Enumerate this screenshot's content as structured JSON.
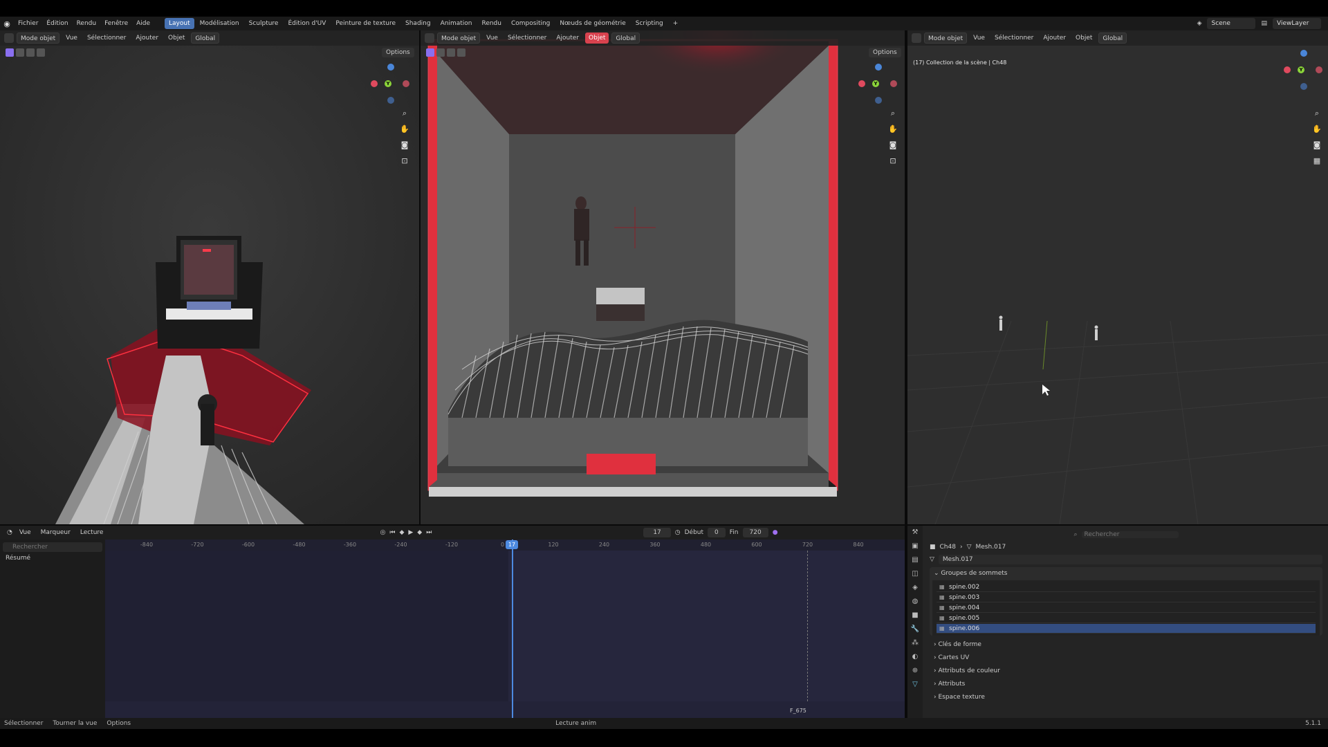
{
  "menu": {
    "items": [
      "Fichier",
      "Édition",
      "Rendu",
      "Fenêtre",
      "Aide"
    ],
    "workspaces": [
      "Layout",
      "Modélisation",
      "Sculpture",
      "Édition d'UV",
      "Peinture de texture",
      "Shading",
      "Animation",
      "Rendu",
      "Compositing",
      "Nœuds de géométrie",
      "Scripting"
    ],
    "active_workspace": "Layout",
    "add_tab": "+",
    "scene": "Scene",
    "view_layer": "ViewLayer"
  },
  "viewport_header": {
    "mode": "Mode objet",
    "vue": "Vue",
    "select": "Sélectionner",
    "add": "Ajouter",
    "object": "Objet",
    "orientation": "Global",
    "options": "Options"
  },
  "viewport3": {
    "info_line": "(17) Collection de la scène | Ch48"
  },
  "timeline": {
    "vue": "Vue",
    "marker": "Marqueur",
    "playback": "Lecture",
    "search_placeholder": "Rechercher",
    "summary": "Résumé",
    "current_frame": "17",
    "start_label": "Début",
    "start": "0",
    "end_label": "Fin",
    "end": "720",
    "marker_label": "F_675",
    "ruler": [
      "-840",
      "-720",
      "-600",
      "-480",
      "-360",
      "-240",
      "-120",
      "0",
      "120",
      "240",
      "360",
      "480",
      "600",
      "720",
      "840"
    ]
  },
  "properties": {
    "search_placeholder": "Rechercher",
    "object": "Ch48",
    "mesh": "Mesh.017",
    "mesh_field": "Mesh.017",
    "vertex_groups_title": "Groupes de sommets",
    "vertex_groups": [
      "spine.002",
      "spine.003",
      "spine.004",
      "spine.005",
      "spine.006"
    ],
    "panels": [
      "Clés de forme",
      "Cartes UV",
      "Attributs de couleur",
      "Attributs",
      "Espace texture"
    ]
  },
  "status": {
    "select": "Sélectionner",
    "rotate": "Tourner la vue",
    "options": "Options",
    "center": "Lecture anim",
    "version": "5.1.1"
  }
}
